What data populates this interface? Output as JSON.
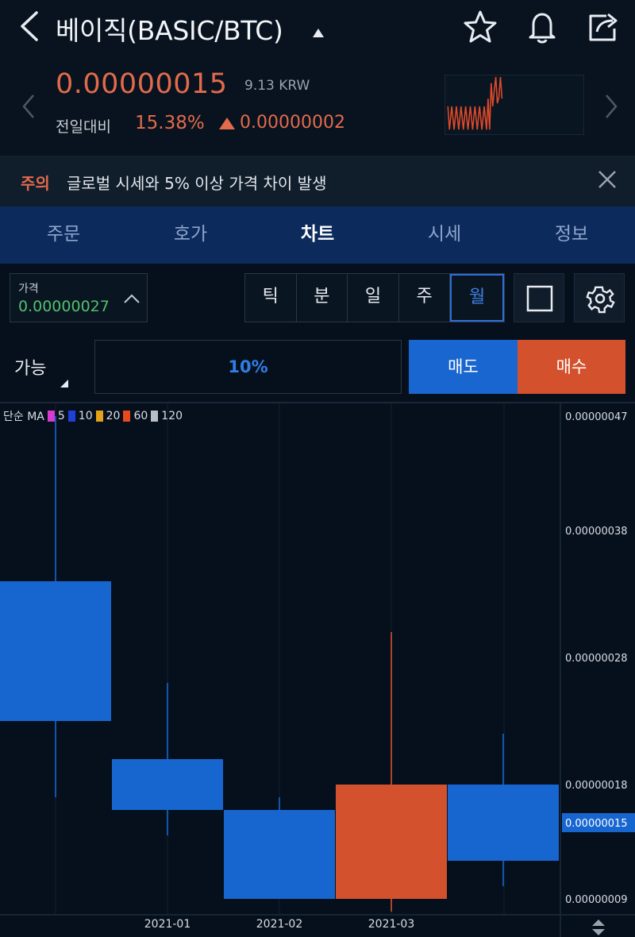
{
  "header": {
    "title": "베이직(BASIC/BTC)",
    "icons": [
      "chevron-left-icon",
      "star-icon",
      "bell-icon",
      "share-icon"
    ]
  },
  "summary": {
    "price": "0.00000015",
    "krw": "9.13 KRW",
    "change_label": "전일대비",
    "change_percent": "15.38%",
    "change_amount": "0.00000002",
    "up_color": "#e36a4b"
  },
  "notice": {
    "tag": "주의",
    "text": "글로벌 시세와 5% 이상 가격 차이 발생"
  },
  "tabs": [
    {
      "label": "주문",
      "active": false
    },
    {
      "label": "호가",
      "active": false
    },
    {
      "label": "차트",
      "active": true
    },
    {
      "label": "시세",
      "active": false
    },
    {
      "label": "정보",
      "active": false
    }
  ],
  "controls": {
    "price_label": "가격",
    "price_value": "0.00000027",
    "periods": [
      {
        "label": "틱",
        "active": false
      },
      {
        "label": "분",
        "active": false
      },
      {
        "label": "일",
        "active": false
      },
      {
        "label": "주",
        "active": false
      },
      {
        "label": "월",
        "active": true
      }
    ],
    "available_label": "가능",
    "percent": "10%",
    "sell_label": "매도",
    "buy_label": "매수"
  },
  "chart_data": {
    "type": "candlestick",
    "legend": {
      "prefix": "단순 MA",
      "items": [
        {
          "label": "5",
          "color": "#d63ad0"
        },
        {
          "label": "10",
          "color": "#1f3fd6"
        },
        {
          "label": "20",
          "color": "#e3a21a"
        },
        {
          "label": "60",
          "color": "#e84a1c"
        },
        {
          "label": "120",
          "color": "#b8bec6"
        }
      ]
    },
    "y_ticks": [
      "0.00000047",
      "0.00000038",
      "0.00000028",
      "0.00000018",
      "0.00000009"
    ],
    "y_tick_values": [
      47,
      38,
      28,
      18,
      9
    ],
    "ylim": [
      9,
      47
    ],
    "y_unit_note": "values in 1e-8 BTC",
    "current_price_label": "0.00000015",
    "current_price_value": 15,
    "x_labels": [
      "2021-01",
      "2021-02",
      "2021-03"
    ],
    "candles": [
      {
        "open": 34,
        "close": 23,
        "high": 47,
        "low": 17,
        "dir": "down"
      },
      {
        "open": 20,
        "close": 16,
        "high": 26,
        "low": 14,
        "dir": "down"
      },
      {
        "open": 16,
        "close": 9,
        "high": 17,
        "low": 9,
        "dir": "down"
      },
      {
        "open": 9,
        "close": 18,
        "high": 30,
        "low": 8,
        "dir": "up"
      },
      {
        "open": 18,
        "close": 12,
        "high": 22,
        "low": 10,
        "dir": "down"
      }
    ],
    "up_color": "#d4512e",
    "down_color": "#1766d0"
  }
}
